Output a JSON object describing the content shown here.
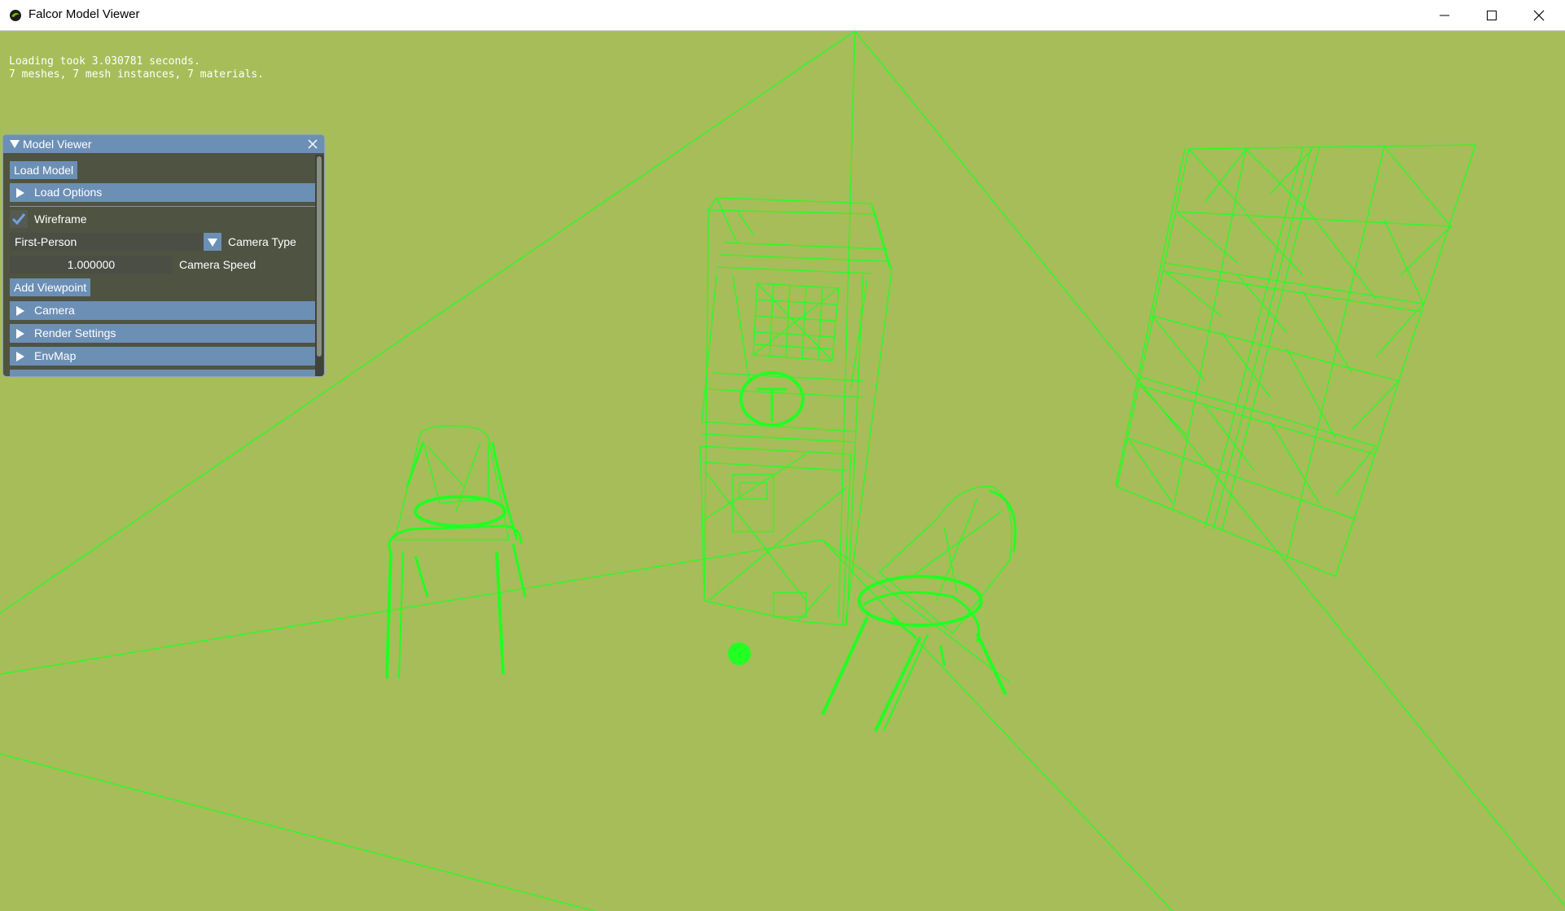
{
  "window": {
    "title": "Falcor Model Viewer",
    "controls": [
      "minimize-icon",
      "maximize-icon",
      "close-icon"
    ]
  },
  "stats": {
    "line1": "Loading took 3.030781 seconds.",
    "line2": "7 meshes, 7 mesh instances, 7 materials."
  },
  "panel": {
    "title": "Model Viewer",
    "load_model": "Load Model",
    "load_options": "Load Options",
    "wireframe_label": "Wireframe",
    "wireframe_checked": true,
    "camera_type_value": "First-Person",
    "camera_type_label": "Camera Type",
    "camera_speed_value": "1.000000",
    "camera_speed_label": "Camera Speed",
    "add_viewpoint": "Add Viewpoint",
    "sections": [
      "Camera",
      "Render Settings",
      "EnvMap"
    ]
  },
  "colors": {
    "background": "#a6bd5a",
    "wireframe": "#22ff22",
    "panel_accent": "#6c8fb5"
  }
}
